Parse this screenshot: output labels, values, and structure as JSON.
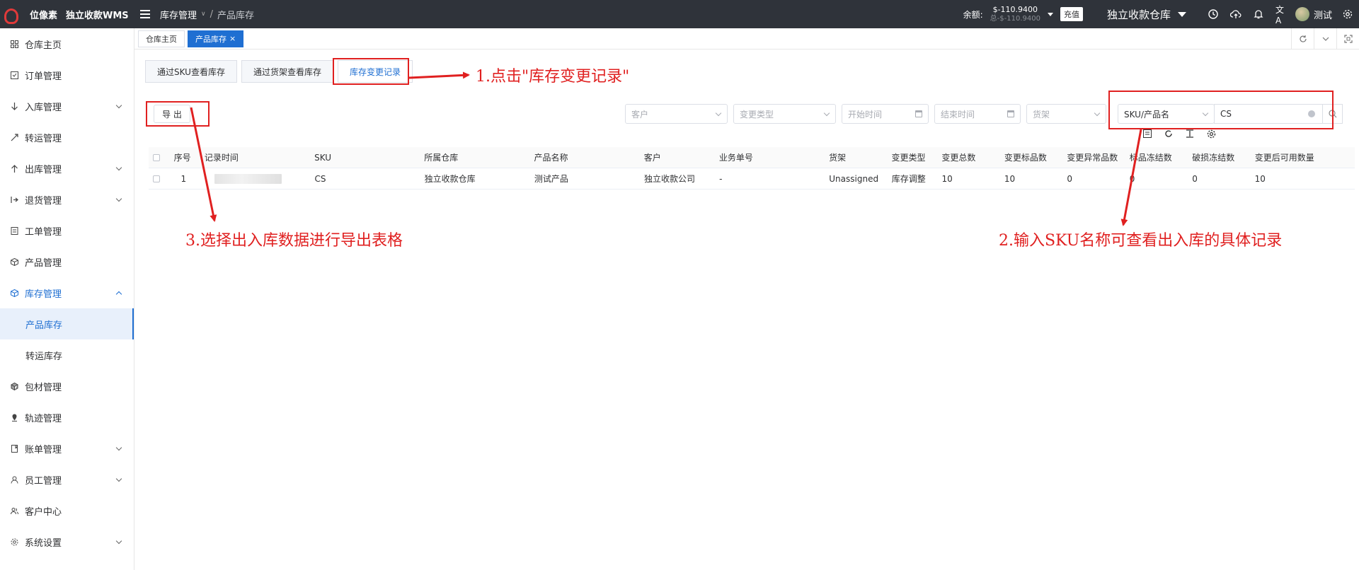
{
  "topbar": {
    "brand": "位像素",
    "system": "独立收款WMS",
    "breadcrumb": [
      "库存管理",
      "产品库存"
    ],
    "balance_label": "余额:",
    "balance_value": "$-110.9400",
    "balance_total": "总-$-110.9400",
    "recharge": "充值",
    "warehouse": "独立收款仓库",
    "user": "测试",
    "icons": [
      "clock-icon",
      "cloud-upload-icon",
      "bell-icon",
      "translate-icon",
      "settings-icon"
    ]
  },
  "sidebar": {
    "items": [
      {
        "label": "仓库主页",
        "icon": "grid-icon",
        "expandable": false
      },
      {
        "label": "订单管理",
        "icon": "order-icon",
        "expandable": false
      },
      {
        "label": "入库管理",
        "icon": "arrow-down-icon",
        "expandable": true
      },
      {
        "label": "转运管理",
        "icon": "transfer-icon",
        "expandable": false
      },
      {
        "label": "出库管理",
        "icon": "arrow-up-icon",
        "expandable": true
      },
      {
        "label": "退货管理",
        "icon": "return-icon",
        "expandable": true
      },
      {
        "label": "工单管理",
        "icon": "ticket-icon",
        "expandable": false
      },
      {
        "label": "产品管理",
        "icon": "box-icon",
        "expandable": false
      },
      {
        "label": "库存管理",
        "icon": "inventory-icon",
        "expandable": true,
        "expanded": true
      },
      {
        "label": "包材管理",
        "icon": "package-icon",
        "expandable": false
      },
      {
        "label": "轨迹管理",
        "icon": "track-icon",
        "expandable": false
      },
      {
        "label": "账单管理",
        "icon": "bill-icon",
        "expandable": true
      },
      {
        "label": "员工管理",
        "icon": "user-icon",
        "expandable": true
      },
      {
        "label": "客户中心",
        "icon": "customer-icon",
        "expandable": false
      },
      {
        "label": "系统设置",
        "icon": "gear-icon",
        "expandable": true
      }
    ],
    "sub_items": [
      "产品库存",
      "转运库存"
    ]
  },
  "page_tabs": {
    "home": "仓库主页",
    "current": "产品库存",
    "close": "×"
  },
  "sub_tabs": [
    "通过SKU查看库存",
    "通过货架查看库存",
    "库存变更记录"
  ],
  "toolbar": {
    "export": "导 出",
    "customer_ph": "客户",
    "change_type_ph": "变更类型",
    "start_ph": "开始时间",
    "end_ph": "结束时间",
    "shelf_ph": "货架",
    "search_type": "SKU/产品名",
    "search_value": "CS"
  },
  "table": {
    "headers": [
      "序号",
      "记录时间",
      "SKU",
      "所属仓库",
      "产品名称",
      "客户",
      "业务单号",
      "货架",
      "变更类型",
      "变更总数",
      "变更标品数",
      "变更异常品数",
      "标品冻结数",
      "破损冻结数",
      "变更后可用数量"
    ],
    "rows": [
      {
        "index": "1",
        "sku": "CS",
        "warehouse": "独立收款仓库",
        "product": "测试产品",
        "customer": "独立收款公司",
        "order_no": "-",
        "shelf": "Unassigned",
        "change_type": "库存调整",
        "total": "10",
        "standard": "10",
        "abnormal": "0",
        "std_frozen": "0",
        "dmg_frozen": "0",
        "available": "10"
      }
    ]
  },
  "annotations": {
    "step1": "1.点击\"库存变更记录\"",
    "step2": "2.输入SKU名称可查看出入库的具体记录",
    "step3": "3.选择出入库数据进行导出表格"
  },
  "colors": {
    "topbar": "#2f333a",
    "accent": "#1f6fd2",
    "annotation": "#e02020"
  }
}
